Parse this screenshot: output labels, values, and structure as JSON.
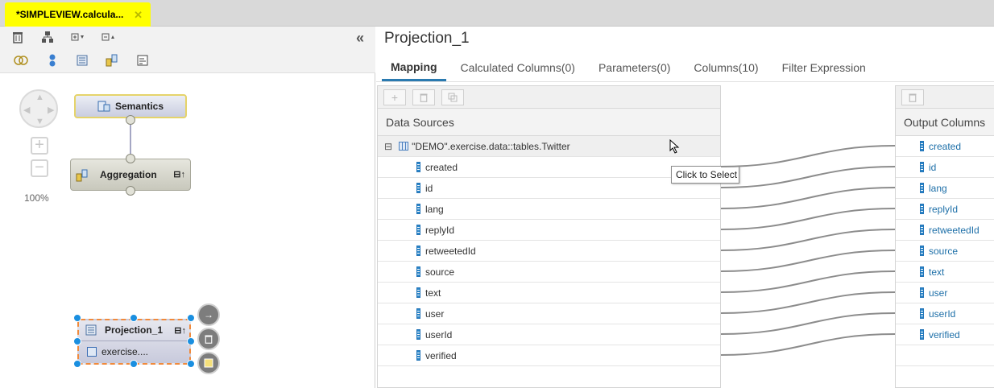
{
  "editor_tab": {
    "title": "*SIMPLEVIEW.calcula...",
    "close": "✕"
  },
  "left_toolbar": {
    "collapse": "«",
    "icons": [
      "delete-icon",
      "hierarchy-icon",
      "expand-all-icon",
      "collapse-all-icon",
      "union-icon",
      "join-icon",
      "projection-icon",
      "aggregation-icon",
      "rank-icon"
    ]
  },
  "canvas": {
    "zoom_label": "100%",
    "nodes": {
      "semantics": "Semantics",
      "aggregation": "Aggregation",
      "projection": "Projection_1",
      "projection_source": "exercise...."
    }
  },
  "details": {
    "title": "Projection_1",
    "tabs": [
      "Mapping",
      "Calculated Columns(0)",
      "Parameters(0)",
      "Columns(10)",
      "Filter Expression"
    ],
    "active_tab": "Mapping",
    "data_sources": {
      "header": "Data Sources",
      "table_name": "\"DEMO\".exercise.data::tables.Twitter",
      "columns": [
        "created",
        "id",
        "lang",
        "replyId",
        "retweetedId",
        "source",
        "text",
        "user",
        "userId",
        "verified"
      ]
    },
    "output_columns": {
      "header": "Output Columns",
      "columns": [
        "created",
        "id",
        "lang",
        "replyId",
        "retweetedId",
        "source",
        "text",
        "user",
        "userId",
        "verified"
      ]
    },
    "tooltip": "Click to Select"
  }
}
